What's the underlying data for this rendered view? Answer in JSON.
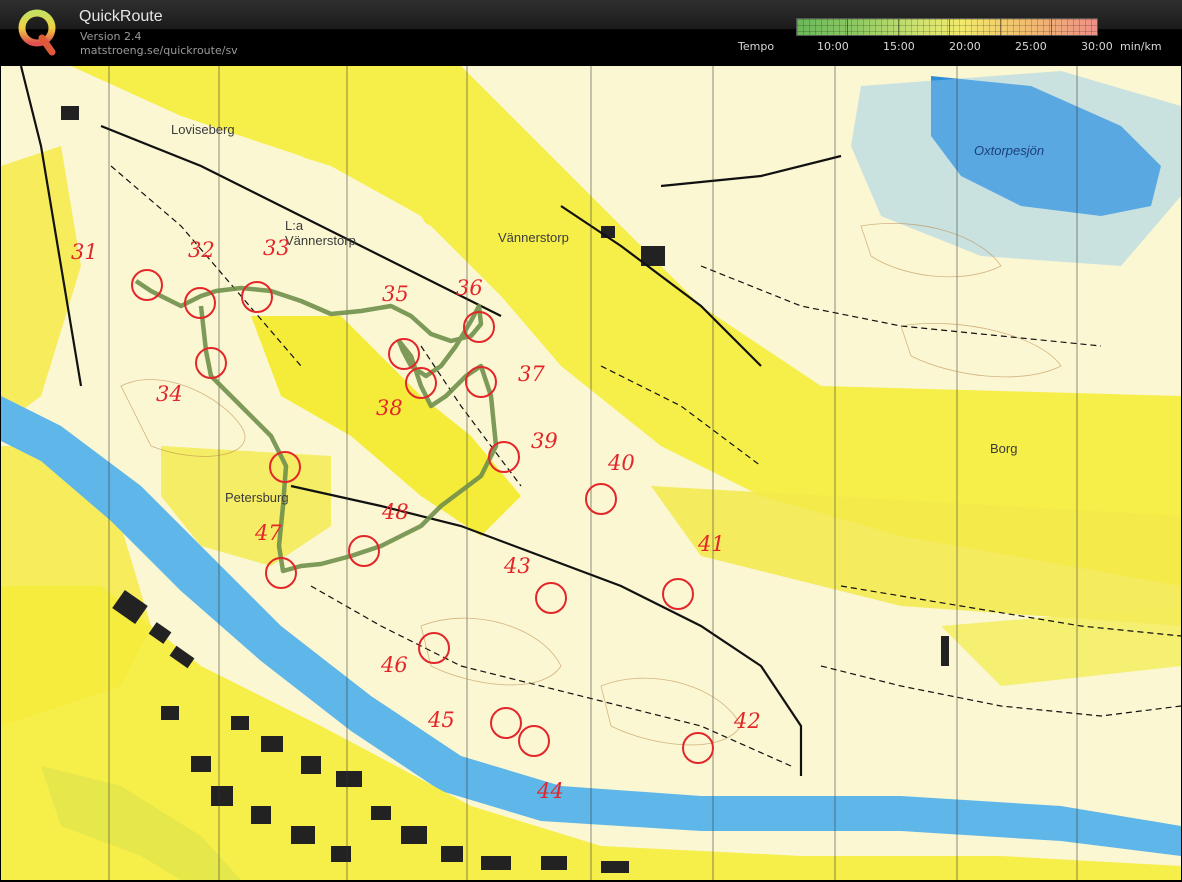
{
  "app": {
    "title": "QuickRoute",
    "version": "Version 2.4",
    "url": "matstroeng.se/quickroute/sv"
  },
  "legend": {
    "label": "Tempo",
    "ticks": [
      "10:00",
      "15:00",
      "20:00",
      "25:00",
      "30:00"
    ],
    "unit": "min/km"
  },
  "map": {
    "place_names": {
      "loviseberg": "Loviseberg",
      "la_vannerstorp": "L:a\nVännerstorp",
      "vannerstorp": "Vännerstorp",
      "oxtorpesjon": "Oxtorpesjön",
      "borg": "Borg",
      "petersburg": "Petersburg"
    },
    "controls": [
      "31",
      "32",
      "33",
      "34",
      "35",
      "36",
      "37",
      "38",
      "39",
      "40",
      "41",
      "42",
      "43",
      "44",
      "45",
      "46",
      "47",
      "48"
    ]
  }
}
